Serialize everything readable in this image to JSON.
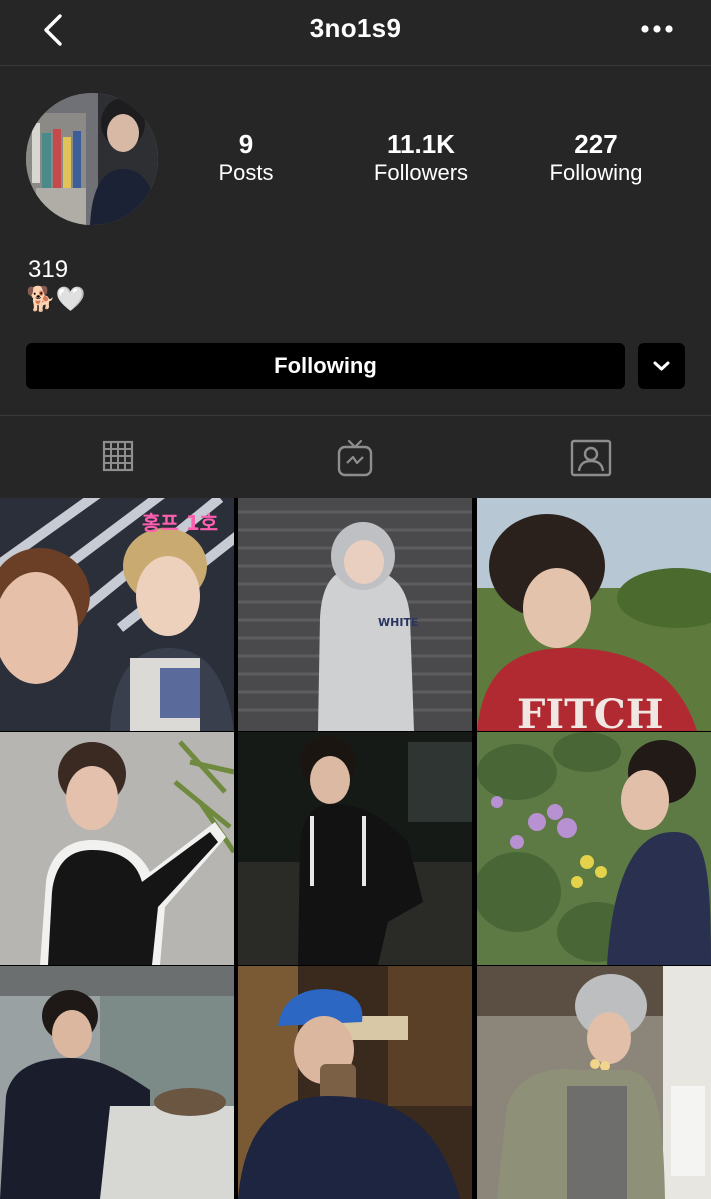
{
  "header": {
    "username": "3no1s9"
  },
  "profile": {
    "stats": [
      {
        "value": "9",
        "label": "Posts"
      },
      {
        "value": "11.1K",
        "label": "Followers"
      },
      {
        "value": "227",
        "label": "Following"
      }
    ],
    "bio_name": "319",
    "bio_emoji": "🐕🤍"
  },
  "actions": {
    "follow_label": "Following"
  },
  "tabs": [
    {
      "icon": "grid-icon"
    },
    {
      "icon": "igtv-icon"
    },
    {
      "icon": "tagged-icon"
    }
  ],
  "posts": [
    {
      "sticker": "홍프 1호"
    },
    {
      "print": "WHITE"
    },
    {
      "print": "FITCH"
    }
  ],
  "colors": {
    "background": "#262626",
    "button": "#000000",
    "divider": "#3a3a3a",
    "text": "#ffffff"
  }
}
